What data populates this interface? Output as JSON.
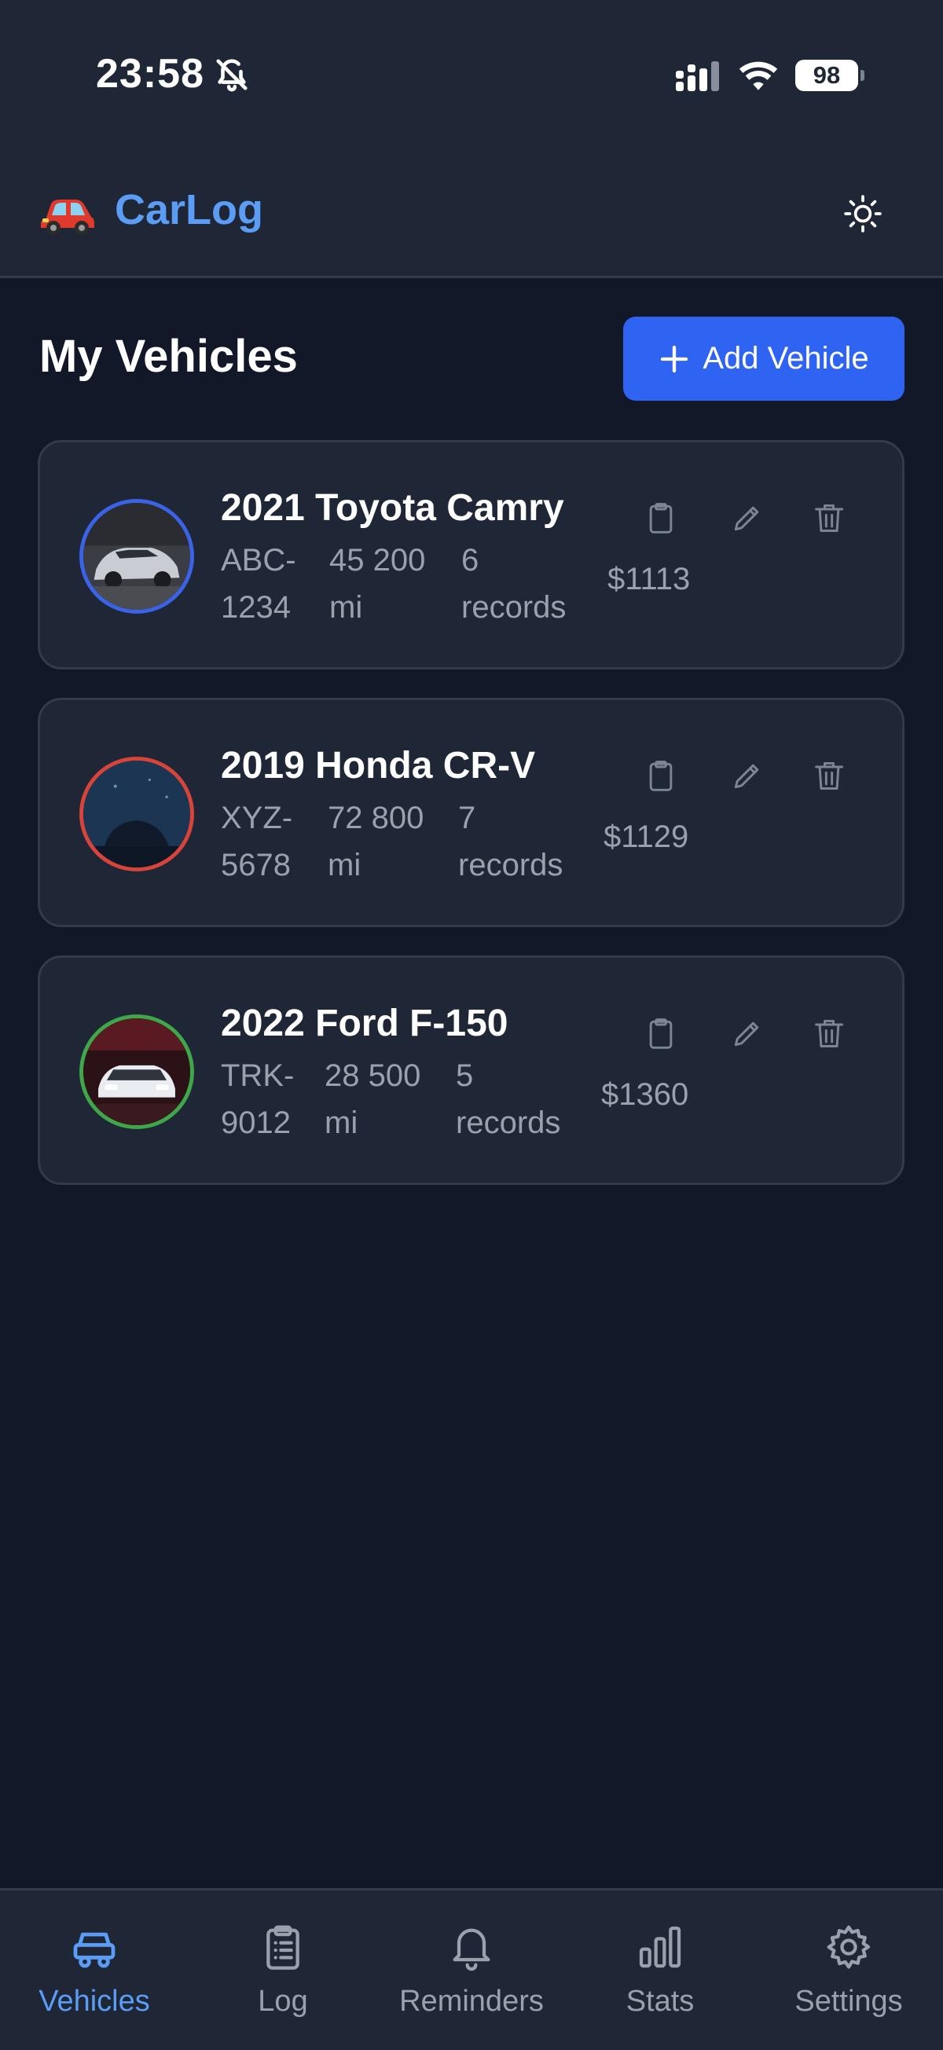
{
  "status_bar": {
    "time": "23:58",
    "battery": "98",
    "icons": [
      "bell-off-icon",
      "signal-icon",
      "wifi-icon",
      "battery-icon"
    ]
  },
  "header": {
    "app_icon": "car-emoji",
    "app_title": "CarLog",
    "theme_icon": "sun-icon"
  },
  "page": {
    "title": "My Vehicles",
    "add_button_label": "Add Vehicle"
  },
  "vehicles": [
    {
      "name": "2021 Toyota Camry",
      "plate_line1": "ABC-",
      "plate_line2": "1234",
      "mileage_line1": "45 200",
      "mileage_line2": "mi",
      "records_line1": "6",
      "records_line2": "records",
      "cost": "$1113",
      "ring_color": "#3b63e8"
    },
    {
      "name": "2019 Honda CR-V",
      "plate_line1": "XYZ-",
      "plate_line2": "5678",
      "mileage_line1": "72 800",
      "mileage_line2": "mi",
      "records_line1": "7",
      "records_line2": "records",
      "cost": "$1129",
      "ring_color": "#d7443a"
    },
    {
      "name": "2022 Ford F-150",
      "plate_line1": "TRK-",
      "plate_line2": "9012",
      "mileage_line1": "28 500",
      "mileage_line2": "mi",
      "records_line1": "5",
      "records_line2": "records",
      "cost": "$1360",
      "ring_color": "#3fa64a"
    }
  ],
  "card_actions": [
    "clipboard-icon",
    "pencil-icon",
    "trash-icon"
  ],
  "nav": [
    {
      "label": "Vehicles",
      "icon": "car-icon",
      "active": true
    },
    {
      "label": "Log",
      "icon": "clipboard-list-icon",
      "active": false
    },
    {
      "label": "Reminders",
      "icon": "bell-icon",
      "active": false
    },
    {
      "label": "Stats",
      "icon": "bar-chart-icon",
      "active": false
    },
    {
      "label": "Settings",
      "icon": "gear-icon",
      "active": false
    }
  ],
  "colors": {
    "background": "#121827",
    "surface": "#1f2636",
    "accent": "#5b9cf5",
    "primary_button": "#2f63f2",
    "muted_text": "#9aa1ad"
  }
}
